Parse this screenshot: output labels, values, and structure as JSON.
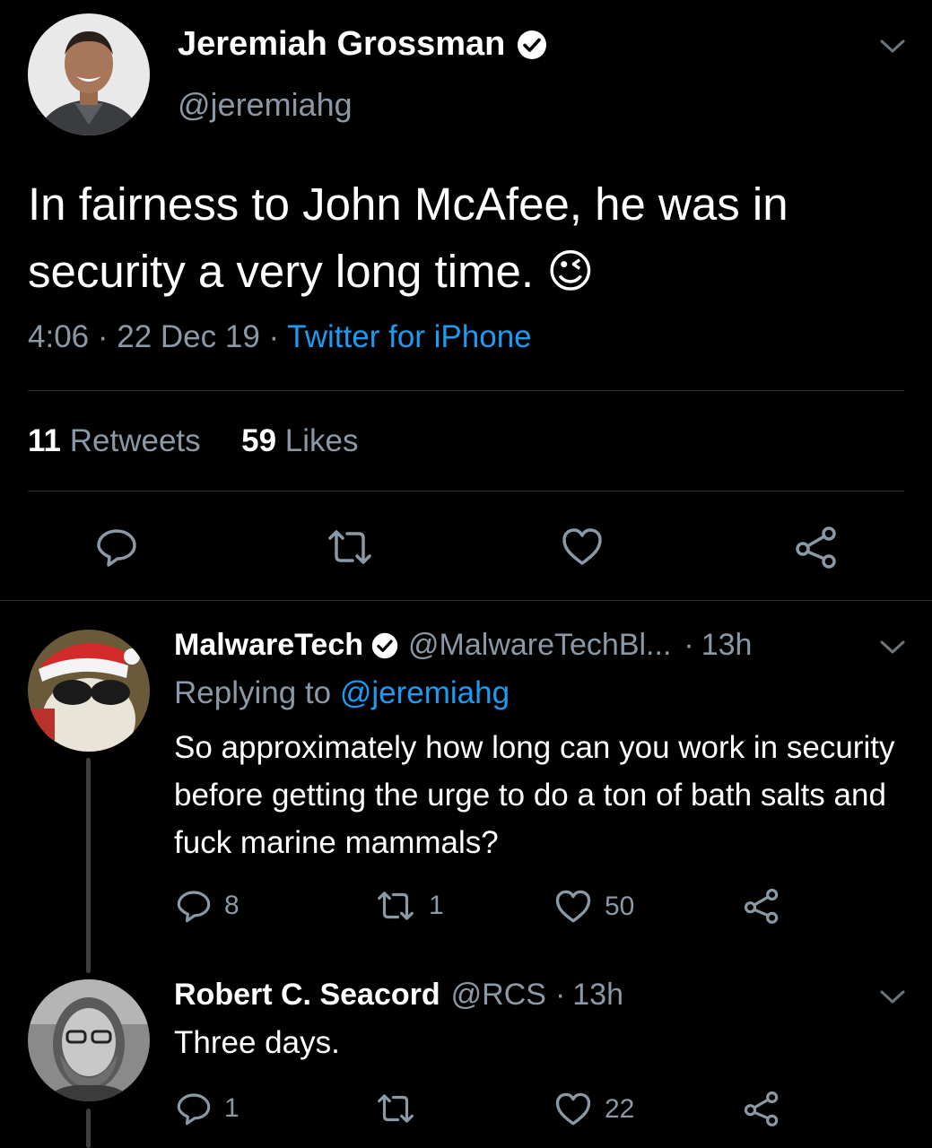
{
  "main_tweet": {
    "author_name": "Jeremiah Grossman",
    "handle": "@jeremiahg",
    "text": "In fairness to John McAfee, he was in security a very long time.",
    "emoji": "😉",
    "time": "4:06",
    "date": "22 Dec 19",
    "separator": "·",
    "source": "Twitter for iPhone",
    "retweets_count": "11",
    "retweets_label": "Retweets",
    "likes_count": "59",
    "likes_label": "Likes"
  },
  "replies": [
    {
      "author_name": "MalwareTech",
      "handle": "@MalwareTechBl...",
      "time_sep": "·",
      "time": "13h",
      "replying_prefix": "Replying to",
      "replying_handle": "@jeremiahg",
      "text": "So approximately how long can you work in security before getting the urge to do a ton of bath salts and fuck marine mammals?",
      "replies_count": "8",
      "retweets_count": "1",
      "likes_count": "50"
    },
    {
      "author_name": "Robert C. Seacord",
      "handle": "@RCS",
      "time_sep": "·",
      "time": "13h",
      "text": "Three days.",
      "replies_count": "1",
      "retweets_count": "",
      "likes_count": "22"
    }
  ],
  "colors": {
    "background": "#000000",
    "text": "#ffffff",
    "secondary": "#8b98a5",
    "link": "#1d9bf0",
    "divider": "#2f3336"
  },
  "icons": [
    "verified-badge-icon",
    "chevron-down-icon",
    "reply-icon",
    "retweet-icon",
    "like-icon",
    "share-icon"
  ]
}
